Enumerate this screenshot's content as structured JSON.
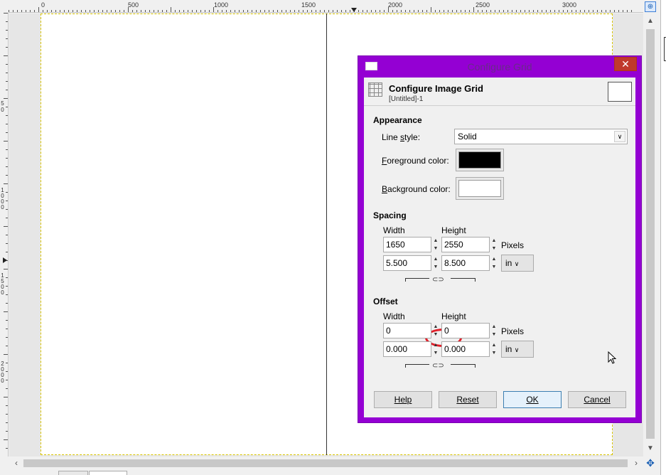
{
  "ruler": {
    "h_labels": [
      "0",
      "500",
      "1000",
      "1500",
      "2000",
      "2500",
      "3000"
    ],
    "v_labels": [
      "5",
      "0",
      "1",
      "0",
      "0",
      "0",
      "1",
      "5",
      "0",
      "0",
      "2",
      "0",
      "0",
      "0"
    ]
  },
  "dialog": {
    "window_title": "Configure Grid",
    "close_glyph": "✕",
    "header_title": "Configure Image Grid",
    "header_subtitle": "[Untitled]-1",
    "appearance": {
      "section": "Appearance",
      "line_style_label_pre": "Line ",
      "line_style_label_u": "s",
      "line_style_label_post": "tyle:",
      "line_style_value": "Solid",
      "fg_label_u": "F",
      "fg_label_post": "oreground color:",
      "fg_color": "#000000",
      "bg_label_u": "B",
      "bg_label_post": "ackground color:",
      "bg_color": "#ffffff"
    },
    "spacing": {
      "section": "Spacing",
      "width_label": "Width",
      "height_label": "Height",
      "width_px": "1650",
      "height_px": "2550",
      "px_unit": "Pixels",
      "width_in": "5.500",
      "height_in": "8.500",
      "unit": "in"
    },
    "offset": {
      "section": "Offset",
      "width_label": "Width",
      "height_label": "Height",
      "width_px": "0",
      "height_px": "0",
      "px_unit": "Pixels",
      "width_in": "0.000",
      "height_in": "0.000",
      "unit": "in"
    },
    "buttons": {
      "help": "Help",
      "reset": "Reset",
      "ok": "OK",
      "cancel": "Cancel"
    }
  },
  "icons": {
    "chain": "chain-link-icon",
    "zoom": "zoom-icon",
    "navigate": "navigate-icon"
  }
}
